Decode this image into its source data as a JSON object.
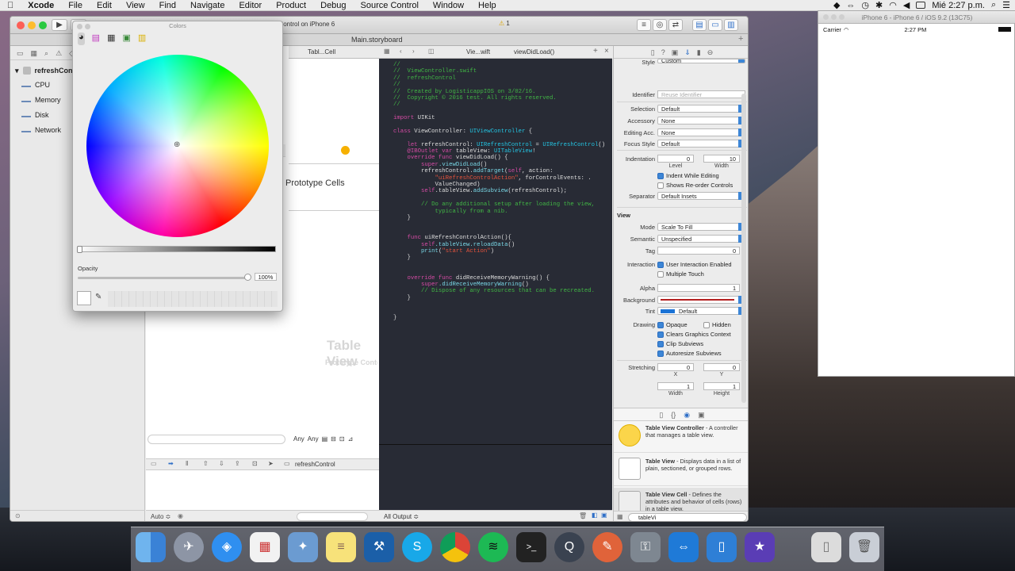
{
  "menubar": {
    "apple": "",
    "app": "Xcode",
    "items": [
      "File",
      "Edit",
      "View",
      "Find",
      "Navigate",
      "Editor",
      "Product",
      "Debug",
      "Source Control",
      "Window",
      "Help"
    ],
    "clock": "Mié 2:27 p.m."
  },
  "xcode": {
    "scheme": "shControl on iPhone 6",
    "warnings": "1",
    "tab": "Main.storyboard",
    "navigator": {
      "root": "refreshControl",
      "items": [
        "CPU",
        "Memory",
        "Disk",
        "Network"
      ]
    },
    "canvas": {
      "section_title": "Prototype Cells",
      "jump_label": "Tabl...Cell",
      "placeholder_title": "Table View",
      "placeholder_sub": "Prototype Content",
      "any_label": "Any",
      "any_label2": "Any",
      "debug_target": "refreshControl",
      "auto_label": "Auto ≎"
    },
    "editor": {
      "jump1": "Vie...wift",
      "jump2": "viewDidLoad()",
      "output_label": "All Output ≎"
    },
    "code_lines": [
      [
        [
          "cm",
          "//"
        ]
      ],
      [
        [
          "cm",
          "//  ViewController.swift"
        ]
      ],
      [
        [
          "cm",
          "//  refreshControl"
        ]
      ],
      [
        [
          "cm",
          "//"
        ]
      ],
      [
        [
          "cm",
          "//  Created by LogisticappIOS on 3/02/16."
        ]
      ],
      [
        [
          "cm",
          "//  Copyright © 2016 test. All rights reserved."
        ]
      ],
      [
        [
          "cm",
          "//"
        ]
      ],
      [],
      [
        [
          "kw",
          "import"
        ],
        [
          "pl",
          " UIKit"
        ]
      ],
      [],
      [
        [
          "kw",
          "class"
        ],
        [
          "pl",
          " ViewController: "
        ],
        [
          "ty",
          "UIViewController"
        ],
        [
          "pl",
          " {"
        ]
      ],
      [],
      [
        [
          "pl",
          "    "
        ],
        [
          "kw",
          "let"
        ],
        [
          "pl",
          " refreshControl: "
        ],
        [
          "ty",
          "UIRefreshControl"
        ],
        [
          "pl",
          " = "
        ],
        [
          "ty",
          "UIRefreshControl"
        ],
        [
          "pl",
          "()"
        ]
      ],
      [
        [
          "pl",
          "    "
        ],
        [
          "kw",
          "@IBOutlet var"
        ],
        [
          "pl",
          " tableView: "
        ],
        [
          "ty",
          "UITableView"
        ],
        [
          "pl",
          "!"
        ]
      ],
      [
        [
          "pl",
          "    "
        ],
        [
          "kw",
          "override func"
        ],
        [
          "pl",
          " viewDidLoad() {"
        ]
      ],
      [
        [
          "pl",
          "        "
        ],
        [
          "kw",
          "super"
        ],
        [
          "fn",
          ".viewDidLoad"
        ],
        [
          "pl",
          "()"
        ]
      ],
      [
        [
          "pl",
          "        refreshControl."
        ],
        [
          "fn",
          "addTarget"
        ],
        [
          "pl",
          "("
        ],
        [
          "kw",
          "self"
        ],
        [
          "pl",
          ", action:"
        ]
      ],
      [
        [
          "pl",
          "            "
        ],
        [
          "st",
          "\"uiRefreshControlAction\""
        ],
        [
          "pl",
          ", forControlEvents: ."
        ]
      ],
      [
        [
          "pl",
          "            ValueChanged)"
        ]
      ],
      [
        [
          "pl",
          "        "
        ],
        [
          "kw",
          "self"
        ],
        [
          "pl",
          ".tableView."
        ],
        [
          "fn",
          "addSubview"
        ],
        [
          "pl",
          "(refreshControl);"
        ]
      ],
      [],
      [
        [
          "pl",
          "        "
        ],
        [
          "cm",
          "// Do any additional setup after loading the view,"
        ]
      ],
      [
        [
          "pl",
          "            "
        ],
        [
          "cm",
          "typically from a nib."
        ]
      ],
      [
        [
          "pl",
          "    }"
        ]
      ],
      [],
      [],
      [
        [
          "pl",
          "    "
        ],
        [
          "kw",
          "func"
        ],
        [
          "pl",
          " uiRefreshControlAction(){"
        ]
      ],
      [
        [
          "pl",
          "        "
        ],
        [
          "kw",
          "self"
        ],
        [
          "fn",
          ".tableView.reloadData"
        ],
        [
          "pl",
          "()"
        ]
      ],
      [
        [
          "pl",
          "        "
        ],
        [
          "fn",
          "print"
        ],
        [
          "pl",
          "("
        ],
        [
          "st",
          "\"start Action\""
        ],
        [
          "pl",
          ")"
        ]
      ],
      [
        [
          "pl",
          "    }"
        ]
      ],
      [],
      [],
      [
        [
          "pl",
          "    "
        ],
        [
          "kw",
          "override func"
        ],
        [
          "pl",
          " didReceiveMemoryWarning() {"
        ]
      ],
      [
        [
          "pl",
          "        "
        ],
        [
          "kw",
          "super"
        ],
        [
          "fn",
          ".didReceiveMemoryWarning"
        ],
        [
          "pl",
          "()"
        ]
      ],
      [
        [
          "pl",
          "        "
        ],
        [
          "cm",
          "// Dispose of any resources that can be recreated."
        ]
      ],
      [
        [
          "pl",
          "    }"
        ]
      ],
      [],
      [],
      [
        [
          "pl",
          "}"
        ]
      ]
    ],
    "inspector": {
      "style_label": "Style",
      "style_value": "Custom",
      "identifier_label": "Identifier",
      "identifier_placeholder": "Reuse Identifier",
      "selection_label": "Selection",
      "selection_value": "Default",
      "accessory_label": "Accessory",
      "accessory_value": "None",
      "editing_acc_label": "Editing Acc.",
      "editing_acc_value": "None",
      "focus_label": "Focus Style",
      "focus_value": "Default",
      "indentation_label": "Indentation",
      "indent_level": "0",
      "indent_width": "10",
      "level_label": "Level",
      "width_label": "Width",
      "indent_editing": "Indent While Editing",
      "reorder": "Shows Re-order Controls",
      "separator_label": "Separator",
      "separator_value": "Default Insets",
      "view_header": "View",
      "mode_label": "Mode",
      "mode_value": "Scale To Fill",
      "semantic_label": "Semantic",
      "semantic_value": "Unspecified",
      "tag_label": "Tag",
      "tag_value": "0",
      "interaction_label": "Interaction",
      "user_interaction": "User Interaction Enabled",
      "multiple_touch": "Multiple Touch",
      "alpha_label": "Alpha",
      "alpha_value": "1",
      "background_label": "Background",
      "tint_label": "Tint",
      "tint_value": "Default",
      "drawing_label": "Drawing",
      "opaque": "Opaque",
      "hidden": "Hidden",
      "clears": "Clears Graphics Context",
      "clip": "Clip Subviews",
      "autoresize": "Autoresize Subviews",
      "stretching_label": "Stretching",
      "stretch_x": "0",
      "stretch_y": "0",
      "stretch_w": "1",
      "stretch_h": "1",
      "x_label": "X",
      "y_label": "Y",
      "w_label": "Width",
      "h_label": "Height"
    },
    "library": {
      "items": [
        {
          "title": "Table View Controller",
          "desc": " - A controller that manages a table view."
        },
        {
          "title": "Table View",
          "desc": " - Displays data in a list of plain, sectioned, or grouped rows."
        },
        {
          "title": "Table View Cell",
          "desc": " - Defines the attributes and behavior of cells (rows) in a table view."
        }
      ],
      "filter_value": "tableVi"
    }
  },
  "colors_panel": {
    "title": "Colors",
    "opacity_label": "Opacity",
    "opacity_value": "100%"
  },
  "simulator": {
    "title": "iPhone 6 - iPhone 6 / iOS 9.2 (13C75)",
    "carrier": "Carrier",
    "time": "2:27 PM"
  },
  "dock": {
    "apps": [
      "Finder",
      "Launchpad",
      "Safari",
      "Photo Booth",
      "Preview",
      "Notes",
      "Xcode",
      "Skype",
      "Chrome",
      "Spotify",
      "Terminal",
      "QuickTime",
      "Instruments",
      "Keychain",
      "TeamViewer",
      "Simulator",
      "iMovie",
      "Documents",
      "Trash"
    ]
  }
}
